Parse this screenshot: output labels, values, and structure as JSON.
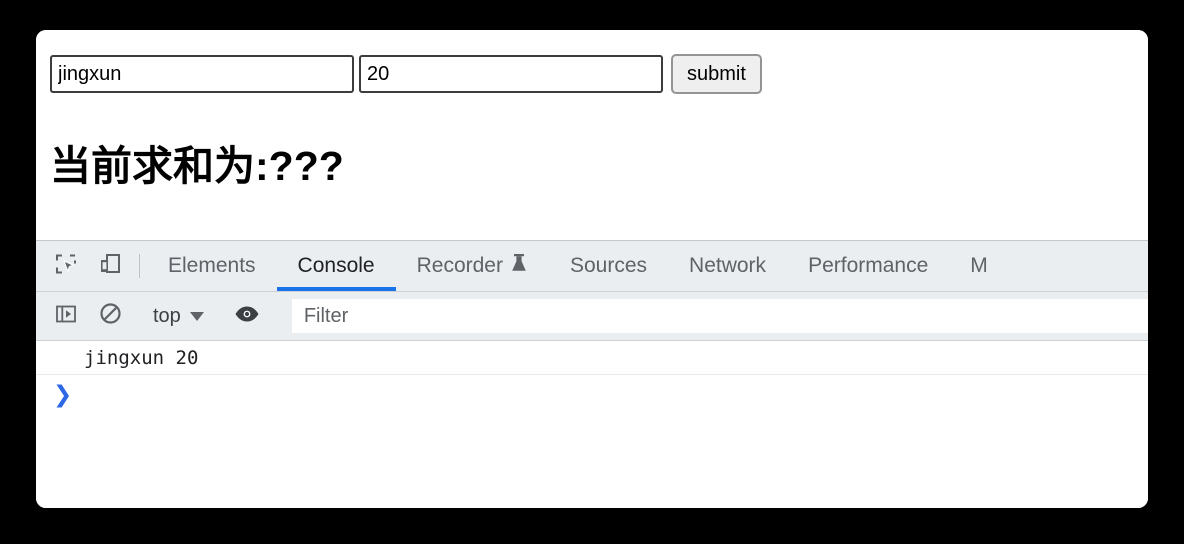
{
  "page": {
    "inputs": [
      {
        "name": "name-input",
        "value": "jingxun",
        "placeholder": ""
      },
      {
        "name": "number-input",
        "value": "20",
        "placeholder": ""
      }
    ],
    "submit_label": "submit",
    "heading": "当前求和为:???"
  },
  "devtools": {
    "icons": {
      "inspect": "inspect-element-icon",
      "device": "device-toolbar-icon"
    },
    "tabs": [
      {
        "label": "Elements",
        "active": false,
        "icon": ""
      },
      {
        "label": "Console",
        "active": true,
        "icon": ""
      },
      {
        "label": "Recorder",
        "active": false,
        "icon": "flask-icon"
      },
      {
        "label": "Sources",
        "active": false,
        "icon": ""
      },
      {
        "label": "Network",
        "active": false,
        "icon": ""
      },
      {
        "label": "Performance",
        "active": false,
        "icon": ""
      },
      {
        "label": "M",
        "active": false,
        "icon": ""
      }
    ],
    "console_toolbar": {
      "sidebar_icon": "console-sidebar-icon",
      "clear_icon": "clear-console-icon",
      "context": "top",
      "eye_icon": "live-expression-eye-icon",
      "filter_placeholder": "Filter",
      "filter_value": ""
    },
    "console": {
      "messages": [
        {
          "text": "jingxun 20"
        }
      ],
      "prompt_symbol": "❯",
      "prompt_value": ""
    }
  },
  "colors": {
    "accent_blue": "#1a73e8",
    "prompt_blue": "#2d68e8",
    "toolbar_bg": "#ebeef0",
    "page_bg": "#ffffff",
    "backdrop": "#000000"
  }
}
